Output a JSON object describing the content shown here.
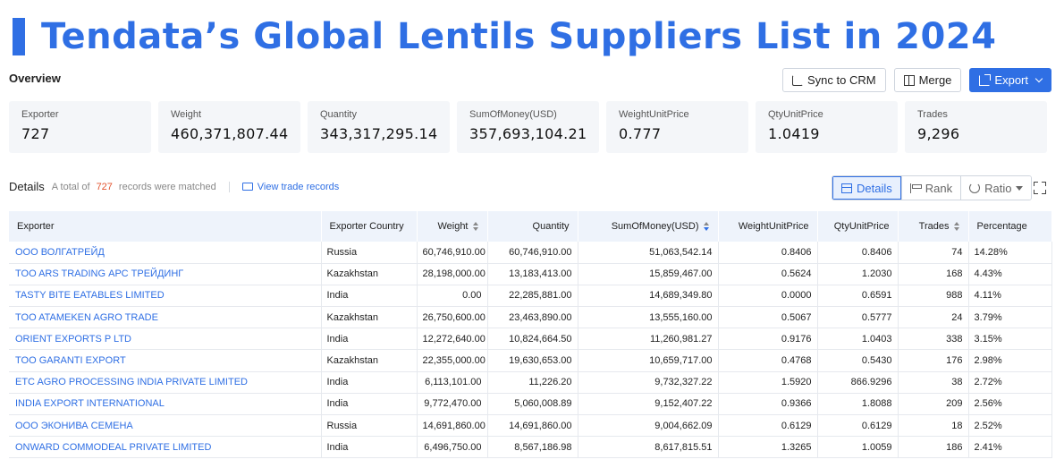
{
  "banner": {
    "title": "Tendata’s Global Lentils Suppliers List in 2024",
    "accent": "#2f6fe4"
  },
  "overview": {
    "label": "Overview"
  },
  "actions": {
    "sync": "Sync to CRM",
    "merge": "Merge",
    "export": "Export"
  },
  "stats": [
    {
      "label": "Exporter",
      "value": "727"
    },
    {
      "label": "Weight",
      "value": "460,371,807.44"
    },
    {
      "label": "Quantity",
      "value": "343,317,295.14"
    },
    {
      "label": "SumOfMoney(USD)",
      "value": "357,693,104.21"
    },
    {
      "label": "WeightUnitPrice",
      "value": "0.777"
    },
    {
      "label": "QtyUnitPrice",
      "value": "1.0419"
    },
    {
      "label": "Trades",
      "value": "9,296"
    }
  ],
  "details": {
    "title": "Details",
    "total_prefix": "A total of",
    "count": "727",
    "total_suffix": "records were matched",
    "view_link": "View trade records"
  },
  "view_tabs": {
    "details": "Details",
    "rank": "Rank",
    "ratio": "Ratio"
  },
  "table": {
    "headers": [
      "Exporter",
      "Exporter Country",
      "Weight",
      "Quantity",
      "SumOfMoney(USD)",
      "WeightUnitPrice",
      "QtyUnitPrice",
      "Trades",
      "Percentage"
    ],
    "rows": [
      [
        "ООО ВОЛГАТРЕЙД",
        "Russia",
        "60,746,910.00",
        "60,746,910.00",
        "51,063,542.14",
        "0.8406",
        "0.8406",
        "74",
        "14.28%"
      ],
      [
        "TOO ARS TRADING АРС ТРЕЙДИНГ",
        "Kazakhstan",
        "28,198,000.00",
        "13,183,413.00",
        "15,859,467.00",
        "0.5624",
        "1.2030",
        "168",
        "4.43%"
      ],
      [
        "TASTY BITE EATABLES LIMITED",
        "India",
        "0.00",
        "22,285,881.00",
        "14,689,349.80",
        "0.0000",
        "0.6591",
        "988",
        "4.11%"
      ],
      [
        "TOO ATAMEKEN AGRO TRADE",
        "Kazakhstan",
        "26,750,600.00",
        "23,463,890.00",
        "13,555,160.00",
        "0.5067",
        "0.5777",
        "24",
        "3.79%"
      ],
      [
        "ORIENT EXPORTS P LTD",
        "India",
        "12,272,640.00",
        "10,824,664.50",
        "11,260,981.27",
        "0.9176",
        "1.0403",
        "338",
        "3.15%"
      ],
      [
        "TOO GARANTI EXPORT",
        "Kazakhstan",
        "22,355,000.00",
        "19,630,653.00",
        "10,659,717.00",
        "0.4768",
        "0.5430",
        "176",
        "2.98%"
      ],
      [
        "ETC AGRO PROCESSING INDIA PRIVATE LIMITED",
        "India",
        "6,113,101.00",
        "11,226.20",
        "9,732,327.22",
        "1.5920",
        "866.9296",
        "38",
        "2.72%"
      ],
      [
        "INDIA EXPORT INTERNATIONAL",
        "India",
        "9,772,470.00",
        "5,060,008.89",
        "9,152,407.22",
        "0.9366",
        "1.8088",
        "209",
        "2.56%"
      ],
      [
        "ООО ЭКОНИВА СЕМЕНА",
        "Russia",
        "14,691,860.00",
        "14,691,860.00",
        "9,004,662.09",
        "0.6129",
        "0.6129",
        "18",
        "2.52%"
      ],
      [
        "ONWARD COMMODEAL PRIVATE LIMITED",
        "India",
        "6,496,750.00",
        "8,567,186.98",
        "8,617,815.51",
        "1.3265",
        "1.0059",
        "186",
        "2.41%"
      ]
    ]
  }
}
